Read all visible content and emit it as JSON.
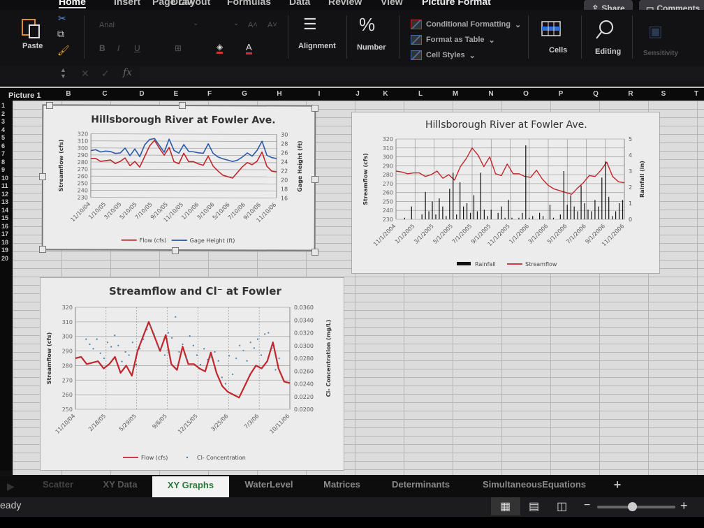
{
  "ribbon": {
    "tabs": [
      "Home",
      "Insert",
      "Draw",
      "Page Layout",
      "Formulas",
      "Data",
      "Review",
      "View",
      "Picture Format"
    ],
    "active_tab": "Home",
    "paste_label": "Paste",
    "font_name": "Arial",
    "alignment_label": "Alignment",
    "number_label": "Number",
    "conditional_formatting": "Conditional Formatting",
    "format_as_table": "Format as Table",
    "cell_styles": "Cell Styles",
    "cells_label": "Cells",
    "editing_label": "Editing",
    "sensitivity_label": "Sensitivity",
    "share_label": "Share",
    "comments_label": "Comments",
    "accent_color": "#d13438"
  },
  "formula_bar": {
    "fx": "fx",
    "name_box": "Picture 1",
    "value": ""
  },
  "columns": [
    "B",
    "C",
    "D",
    "E",
    "F",
    "G",
    "H",
    "I",
    "J",
    "K",
    "L",
    "M",
    "N",
    "O",
    "P",
    "Q",
    "R",
    "S",
    "T"
  ],
  "rows": [
    "1",
    "2",
    "3",
    "4",
    "5",
    "6",
    "7",
    "8",
    "9",
    "10",
    "11",
    "12",
    "13",
    "14",
    "15",
    "16",
    "17",
    "18",
    "19",
    "20"
  ],
  "sheet_tabs": [
    "Scatter",
    "XY Data",
    "XY Graphs",
    "WaterLevel",
    "Matrices",
    "Determinants",
    "SimultaneousEquations"
  ],
  "active_sheet": "XY Graphs",
  "add_sheet": "+",
  "status": {
    "text": "eady",
    "zoom_minus": "−",
    "zoom_plus": "+",
    "zoom_level": 0.45
  },
  "chart_data": [
    {
      "type": "line",
      "title": "Hillsborough River at Fowler Ave.",
      "ylabel": "Streamflow (cfs)",
      "y2label": "Gage Height (ft)",
      "ylim": [
        230,
        320
      ],
      "y2lim": [
        16,
        30
      ],
      "yticks": [
        "320",
        "310",
        "300",
        "290",
        "280",
        "270",
        "260",
        "250",
        "240",
        "230"
      ],
      "y2ticks": [
        "30",
        "28",
        "26",
        "24",
        "22",
        "20",
        "18",
        "16"
      ],
      "xticks": [
        "11/10/04",
        "1/10/05",
        "3/10/05",
        "5/10/05",
        "7/10/05",
        "9/10/05",
        "11/10/05",
        "1/10/06",
        "3/10/06",
        "5/10/06",
        "7/10/06",
        "9/10/06",
        "11/10/06"
      ],
      "legend": [
        "Flow (cfs)",
        "Gage Height (ft)"
      ],
      "legend_position": "bottom",
      "series": [
        {
          "name": "Flow (cfs)",
          "color": "#c0272d",
          "axis": "left",
          "values": [
            285,
            285,
            281,
            282,
            283,
            278,
            281,
            286,
            275,
            281,
            273,
            288,
            303,
            311,
            300,
            290,
            301,
            281,
            278,
            293,
            281,
            281,
            278,
            276,
            289,
            275,
            268,
            262,
            260,
            258,
            266,
            274,
            280,
            277,
            282,
            295,
            275,
            268,
            267
          ]
        },
        {
          "name": "Gage Height (ft)",
          "color": "#2b5ba8",
          "axis": "right",
          "values": [
            26.3,
            26.5,
            26.0,
            26.2,
            26.1,
            25.7,
            25.8,
            26.9,
            25.2,
            26.7,
            25.0,
            27.6,
            28.8,
            29.0,
            27.5,
            26.0,
            28.9,
            26.4,
            25.8,
            27.7,
            26.2,
            26.1,
            25.9,
            25.8,
            27.9,
            25.8,
            25.0,
            24.6,
            24.3,
            24.0,
            24.3,
            25.0,
            25.9,
            25.2,
            26.5,
            28.5,
            25.4,
            24.9,
            24.7
          ]
        }
      ]
    },
    {
      "type": "bar",
      "title": "Hillsborough River at Fowler Ave.",
      "ylabel": "Streamflow (cfs)",
      "y2label": "Rainfall (in)",
      "ylim": [
        230,
        320
      ],
      "y2lim": [
        0,
        5
      ],
      "yticks": [
        "320",
        "310",
        "300",
        "290",
        "280",
        "270",
        "260",
        "250",
        "240",
        "230"
      ],
      "y2ticks": [
        "5",
        "4",
        "3",
        "2",
        "1",
        "0"
      ],
      "xticks": [
        "11/1/2004",
        "1/1/2005",
        "3/1/2005",
        "5/1/2005",
        "7/1/2005",
        "9/1/2005",
        "11/1/2005",
        "1/1/2006",
        "3/1/2006",
        "5/1/2006",
        "7/1/2006",
        "9/1/2006",
        "11/1/2006"
      ],
      "legend": [
        "Rainfall",
        "Streamflow"
      ],
      "legend_position": "bottom",
      "series": [
        {
          "name": "Streamflow",
          "color": "#c0272d",
          "axis": "left",
          "values": [
            284,
            283,
            281,
            282,
            282,
            278,
            280,
            284,
            276,
            280,
            274,
            289,
            298,
            310,
            302,
            289,
            300,
            281,
            279,
            292,
            281,
            281,
            278,
            277,
            285,
            275,
            268,
            264,
            262,
            260,
            258,
            265,
            271,
            279,
            278,
            285,
            294,
            278,
            272,
            271
          ]
        },
        {
          "name": "Rainfall",
          "color": "#111111",
          "axis": "right",
          "values": [
            0,
            0,
            0.1,
            0,
            0.8,
            0,
            0,
            0.3,
            1.7,
            0.5,
            1.1,
            0.3,
            1.3,
            0.8,
            0.2,
            1.9,
            2.9,
            0.3,
            2.3,
            0.8,
            1.0,
            0.4,
            1.5,
            0.5,
            2.9,
            0.6,
            0.2,
            0.6,
            0,
            0.4,
            0.8,
            0.1,
            1.2,
            0.1,
            0,
            0.1,
            0.4,
            4.6,
            0.1,
            0.2,
            0,
            0.4,
            0.2,
            0,
            0.9,
            0.1,
            0,
            0.3,
            3.0,
            0.9,
            1.5,
            0.8,
            0.5,
            2.1,
            1.0,
            0.6,
            0.5,
            1.2,
            0.8,
            2.6,
            3.6,
            1.4,
            0.2,
            0.5,
            1.0,
            1.2
          ]
        }
      ]
    },
    {
      "type": "scatter",
      "title": "Streamflow and Cl⁻ at Fowler",
      "ylabel": "Streamflow (cfs)",
      "y2label": "Cl- Concentration (mg/L)",
      "ylim": [
        250,
        320
      ],
      "y2lim": [
        0.02,
        0.036
      ],
      "yticks": [
        "320",
        "310",
        "300",
        "290",
        "280",
        "270",
        "260",
        "250"
      ],
      "y2ticks": [
        "0.0360",
        "0.0340",
        "0.0320",
        "0.0300",
        "0.0280",
        "0.0260",
        "0.0240",
        "0.0220",
        "0.0200"
      ],
      "xticks": [
        "11/10/04",
        "2/18/05",
        "5/29/05",
        "9/6/05",
        "12/15/05",
        "3/25/06",
        "7/3/06",
        "10/11/06"
      ],
      "legend": [
        "Flow (cfs)",
        "Cl- Concentration"
      ],
      "legend_position": "bottom",
      "series": [
        {
          "name": "Flow (cfs)",
          "color": "#c0272d",
          "axis": "left",
          "values": [
            285,
            286,
            281,
            282,
            283,
            278,
            281,
            286,
            275,
            280,
            273,
            290,
            300,
            310,
            300,
            290,
            301,
            281,
            277,
            293,
            281,
            281,
            278,
            276,
            289,
            275,
            266,
            262,
            260,
            258,
            266,
            274,
            280,
            278,
            283,
            296,
            278,
            269,
            268
          ]
        },
        {
          "name": "Cl- Concentration",
          "color": "#4a7fa8",
          "axis": "right",
          "values": [
            0.031,
            0.0302,
            0.0295,
            0.031,
            0.0288,
            0.028,
            0.0305,
            0.0298,
            0.0316,
            0.03,
            0.0275,
            0.029,
            0.0285,
            0.0305,
            0.027,
            0.0295,
            0.031,
            0.0325,
            0.033,
            0.0318,
            0.03,
            0.0296,
            0.0285,
            0.032,
            0.0312,
            0.0345,
            0.029,
            0.0302,
            0.028,
            0.0315,
            0.03,
            0.0285,
            0.027,
            0.0295,
            0.0278,
            0.0282,
            0.029,
            0.0276,
            0.025,
            0.024,
            0.0284,
            0.0255,
            0.028,
            0.03,
            0.0292,
            0.0276,
            0.0305,
            0.0296,
            0.031,
            0.0285,
            0.0318,
            0.032,
            0.0296,
            0.0262,
            0.028
          ]
        }
      ]
    }
  ]
}
